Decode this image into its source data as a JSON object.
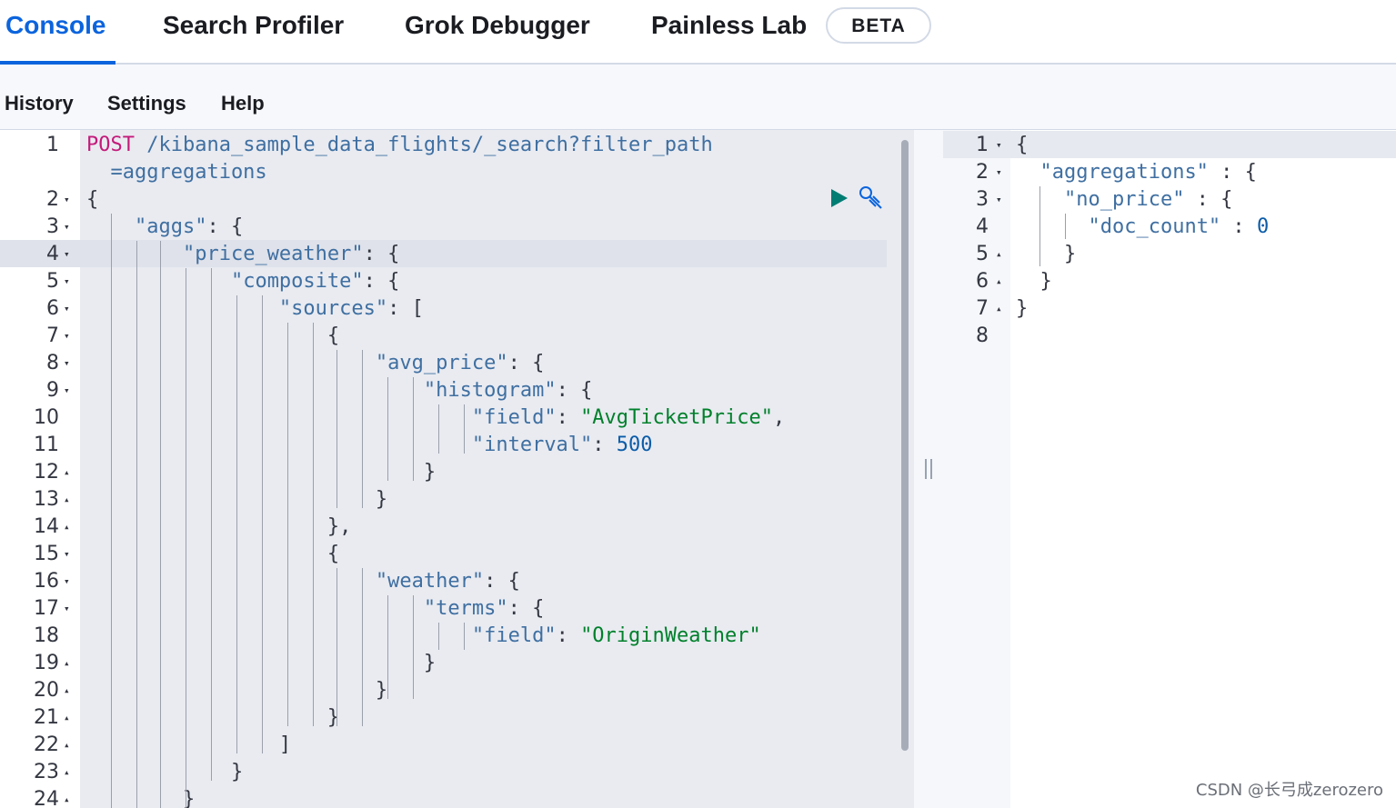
{
  "tabs": [
    {
      "label": "Console",
      "active": true
    },
    {
      "label": "Search Profiler"
    },
    {
      "label": "Grok Debugger"
    },
    {
      "label": "Painless Lab"
    }
  ],
  "beta_badge": "BETA",
  "menu": [
    "History",
    "Settings",
    "Help"
  ],
  "colors": {
    "accent": "#0b64dd",
    "string": "#00802b",
    "key": "#3f6fa1",
    "method": "#c41a7a"
  },
  "editor": {
    "lines": [
      {
        "n": "1",
        "fold": "",
        "code": [
          {
            "t": "POST",
            "c": "m"
          },
          {
            "t": " /kibana_sample_data_flights/_search?filter_path",
            "c": "k"
          }
        ]
      },
      {
        "n": "",
        "fold": "",
        "code": [
          {
            "t": "  =aggregations",
            "c": "k"
          }
        ]
      },
      {
        "n": "2",
        "fold": "▾",
        "code": [
          {
            "t": "{",
            "c": ""
          }
        ]
      },
      {
        "n": "3",
        "fold": "▾",
        "code": [
          {
            "t": "    ",
            "c": ""
          },
          {
            "t": "\"aggs\"",
            "c": "k"
          },
          {
            "t": ": {",
            "c": ""
          }
        ]
      },
      {
        "n": "4",
        "fold": "▾",
        "code": [
          {
            "t": "        ",
            "c": ""
          },
          {
            "t": "\"price_weather\"",
            "c": "k"
          },
          {
            "t": ": {",
            "c": ""
          }
        ]
      },
      {
        "n": "5",
        "fold": "▾",
        "code": [
          {
            "t": "            ",
            "c": ""
          },
          {
            "t": "\"composite\"",
            "c": "k"
          },
          {
            "t": ": {",
            "c": ""
          }
        ]
      },
      {
        "n": "6",
        "fold": "▾",
        "code": [
          {
            "t": "                ",
            "c": ""
          },
          {
            "t": "\"sources\"",
            "c": "k"
          },
          {
            "t": ": [",
            "c": ""
          }
        ]
      },
      {
        "n": "7",
        "fold": "▾",
        "code": [
          {
            "t": "                    {",
            "c": ""
          }
        ]
      },
      {
        "n": "8",
        "fold": "▾",
        "code": [
          {
            "t": "                        ",
            "c": ""
          },
          {
            "t": "\"avg_price\"",
            "c": "k"
          },
          {
            "t": ": {",
            "c": ""
          }
        ]
      },
      {
        "n": "9",
        "fold": "▾",
        "code": [
          {
            "t": "                            ",
            "c": ""
          },
          {
            "t": "\"histogram\"",
            "c": "k"
          },
          {
            "t": ": {",
            "c": ""
          }
        ]
      },
      {
        "n": "10",
        "fold": "",
        "code": [
          {
            "t": "                                ",
            "c": ""
          },
          {
            "t": "\"field\"",
            "c": "k"
          },
          {
            "t": ": ",
            "c": ""
          },
          {
            "t": "\"AvgTicketPrice\"",
            "c": "s"
          },
          {
            "t": ",",
            "c": ""
          }
        ]
      },
      {
        "n": "11",
        "fold": "",
        "code": [
          {
            "t": "                                ",
            "c": ""
          },
          {
            "t": "\"interval\"",
            "c": "k"
          },
          {
            "t": ": ",
            "c": ""
          },
          {
            "t": "500",
            "c": "n"
          }
        ]
      },
      {
        "n": "12",
        "fold": "▴",
        "code": [
          {
            "t": "                            }",
            "c": ""
          }
        ]
      },
      {
        "n": "13",
        "fold": "▴",
        "code": [
          {
            "t": "                        }",
            "c": ""
          }
        ]
      },
      {
        "n": "14",
        "fold": "▴",
        "code": [
          {
            "t": "                    },",
            "c": ""
          }
        ]
      },
      {
        "n": "15",
        "fold": "▾",
        "code": [
          {
            "t": "                    {",
            "c": ""
          }
        ]
      },
      {
        "n": "16",
        "fold": "▾",
        "code": [
          {
            "t": "                        ",
            "c": ""
          },
          {
            "t": "\"weather\"",
            "c": "k"
          },
          {
            "t": ": {",
            "c": ""
          }
        ]
      },
      {
        "n": "17",
        "fold": "▾",
        "code": [
          {
            "t": "                            ",
            "c": ""
          },
          {
            "t": "\"terms\"",
            "c": "k"
          },
          {
            "t": ": {",
            "c": ""
          }
        ]
      },
      {
        "n": "18",
        "fold": "",
        "code": [
          {
            "t": "                                ",
            "c": ""
          },
          {
            "t": "\"field\"",
            "c": "k"
          },
          {
            "t": ": ",
            "c": ""
          },
          {
            "t": "\"OriginWeather\"",
            "c": "s"
          }
        ]
      },
      {
        "n": "19",
        "fold": "▴",
        "code": [
          {
            "t": "                            }",
            "c": ""
          }
        ]
      },
      {
        "n": "20",
        "fold": "▴",
        "code": [
          {
            "t": "                        }",
            "c": ""
          }
        ]
      },
      {
        "n": "21",
        "fold": "▴",
        "code": [
          {
            "t": "                    }",
            "c": ""
          }
        ]
      },
      {
        "n": "22",
        "fold": "▴",
        "code": [
          {
            "t": "                ]",
            "c": ""
          }
        ]
      },
      {
        "n": "23",
        "fold": "▴",
        "code": [
          {
            "t": "            }",
            "c": ""
          }
        ]
      },
      {
        "n": "24",
        "fold": "▴",
        "code": [
          {
            "t": "        }",
            "c": ""
          }
        ]
      }
    ]
  },
  "output": {
    "lines": [
      {
        "n": "1",
        "fold": "▾",
        "code": [
          {
            "t": "{",
            "c": ""
          }
        ]
      },
      {
        "n": "2",
        "fold": "▾",
        "code": [
          {
            "t": "  ",
            "c": ""
          },
          {
            "t": "\"aggregations\"",
            "c": "k"
          },
          {
            "t": " : {",
            "c": ""
          }
        ]
      },
      {
        "n": "3",
        "fold": "▾",
        "code": [
          {
            "t": "    ",
            "c": ""
          },
          {
            "t": "\"no_price\"",
            "c": "k"
          },
          {
            "t": " : {",
            "c": ""
          }
        ]
      },
      {
        "n": "4",
        "fold": "",
        "code": [
          {
            "t": "      ",
            "c": ""
          },
          {
            "t": "\"doc_count\"",
            "c": "k"
          },
          {
            "t": " : ",
            "c": ""
          },
          {
            "t": "0",
            "c": "n"
          }
        ]
      },
      {
        "n": "5",
        "fold": "▴",
        "code": [
          {
            "t": "    }",
            "c": ""
          }
        ]
      },
      {
        "n": "6",
        "fold": "▴",
        "code": [
          {
            "t": "  }",
            "c": ""
          }
        ]
      },
      {
        "n": "7",
        "fold": "▴",
        "code": [
          {
            "t": "}",
            "c": ""
          }
        ]
      },
      {
        "n": "8",
        "fold": "",
        "code": []
      }
    ]
  },
  "watermark": "CSDN @长弓成zerozero"
}
